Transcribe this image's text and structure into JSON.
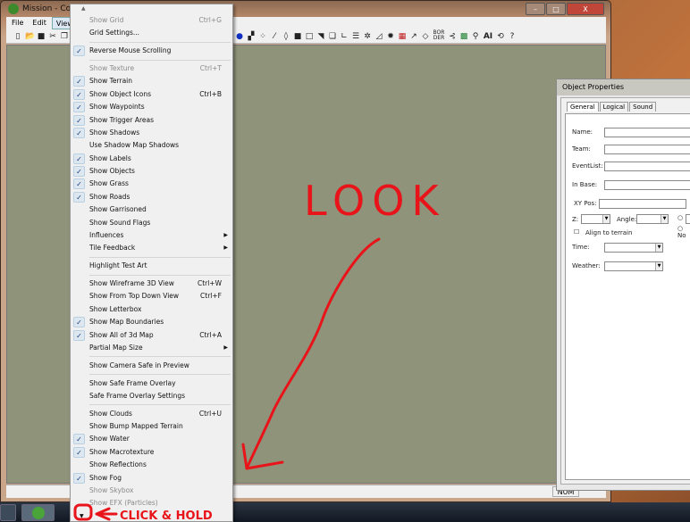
{
  "window": {
    "title": "Mission - Comm",
    "minimize": "–",
    "maximize": "□",
    "close": "X"
  },
  "menubar": [
    "File",
    "Edit",
    "View"
  ],
  "toolbar": {
    "icons": [
      "new-icon",
      "open-icon",
      "save-icon",
      "cut-icon",
      "copy-icon",
      "terrain-icon",
      "water-icon",
      "blocks-icon",
      "pattern-icon",
      "eyedropper-icon",
      "fill-icon",
      "square-icon",
      "rect-icon",
      "corner-icon",
      "copy-objects-icon",
      "axis-icon",
      "lines-icon",
      "tree-icon",
      "triangle-icon",
      "gear-icon",
      "grid-icon",
      "path-icon",
      "polygon-icon",
      "border-icon",
      "link-icon",
      "building-icon",
      "team-icon",
      "ai-icon",
      "history-icon",
      "help-icon"
    ],
    "ai_label": "AI",
    "bor_der": "BOR DER"
  },
  "view_menu": {
    "items": [
      {
        "label": "Show Grid",
        "shortcut": "Ctrl+G",
        "disabled": true
      },
      {
        "label": "Grid Settings..."
      },
      {
        "sep": true
      },
      {
        "label": "Reverse Mouse Scrolling",
        "checked": true
      },
      {
        "sep": true
      },
      {
        "label": "Show Texture",
        "shortcut": "Ctrl+T",
        "disabled": true
      },
      {
        "label": "Show Terrain",
        "checked": true
      },
      {
        "label": "Show Object Icons",
        "checked": true,
        "shortcut": "Ctrl+B"
      },
      {
        "label": "Show Waypoints",
        "checked": true
      },
      {
        "label": "Show Trigger Areas",
        "checked": true
      },
      {
        "label": "Show Shadows",
        "checked": true
      },
      {
        "label": "Use Shadow Map Shadows"
      },
      {
        "label": "Show Labels",
        "checked": true
      },
      {
        "label": "Show Objects",
        "checked": true
      },
      {
        "label": "Show Grass",
        "checked": true
      },
      {
        "label": "Show Roads",
        "checked": true
      },
      {
        "label": "Show Garrisoned"
      },
      {
        "label": "Show Sound Flags"
      },
      {
        "label": "Influences",
        "submenu": true
      },
      {
        "label": "Tile Feedback",
        "submenu": true
      },
      {
        "sep": true
      },
      {
        "label": "Highlight Test Art"
      },
      {
        "sep": true
      },
      {
        "label": "Show Wireframe 3D View",
        "shortcut": "Ctrl+W"
      },
      {
        "label": "Show From Top Down View",
        "shortcut": "Ctrl+F"
      },
      {
        "label": "Show Letterbox"
      },
      {
        "label": "Show Map Boundaries",
        "checked": true
      },
      {
        "label": "Show All of 3d Map",
        "checked": true,
        "shortcut": "Ctrl+A"
      },
      {
        "label": "Partial Map Size",
        "submenu": true
      },
      {
        "sep": true
      },
      {
        "label": "Show Camera Safe in Preview"
      },
      {
        "sep": true
      },
      {
        "label": "Show Safe Frame Overlay"
      },
      {
        "label": "Safe Frame Overlay Settings"
      },
      {
        "sep": true
      },
      {
        "label": "Show Clouds",
        "shortcut": "Ctrl+U"
      },
      {
        "label": "Show Bump Mapped Terrain"
      },
      {
        "label": "Show Water",
        "checked": true
      },
      {
        "label": "Show Macrotexture",
        "checked": true
      },
      {
        "label": "Show Reflections"
      },
      {
        "label": "Show Fog",
        "checked": true
      },
      {
        "label": "Show Skybox",
        "disabled": true
      },
      {
        "label": "Show EFX (Particles)",
        "disabled": true
      }
    ],
    "scroll_up": "▲",
    "scroll_down": "▼"
  },
  "object_properties": {
    "title": "Object Properties",
    "tabs": [
      "General",
      "Logical",
      "Sound"
    ],
    "name_label": "Name:",
    "team_label": "Team:",
    "eventlist_label": "EventList:",
    "inbase_label": "In Base:",
    "xypos_label": "XY Pos:",
    "z_label": "Z:",
    "angle_label": "Angle:",
    "align_label": "Align to terrain",
    "no_label": "No",
    "time_label": "Time:",
    "weather_label": "Weather:"
  },
  "status": {
    "num": "NUM"
  },
  "annotations": {
    "look": "LOOK",
    "click_hold": "CLICK & HOLD",
    "color": "#e8141a"
  }
}
